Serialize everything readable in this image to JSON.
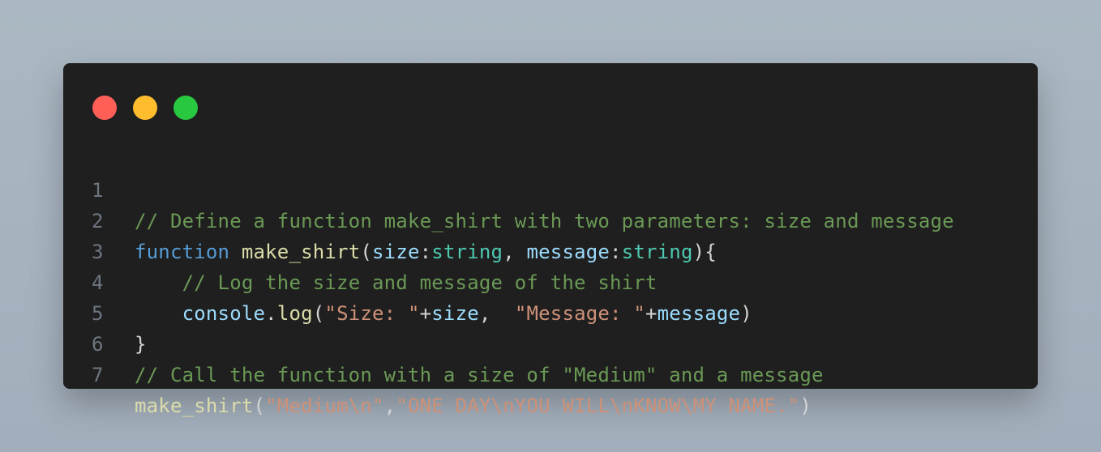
{
  "window": {
    "controls": {
      "close_color": "#ff5f57",
      "minimize_color": "#ffbd2e",
      "maximize_color": "#28c840"
    }
  },
  "code": {
    "lines": [
      {
        "number": "1",
        "tokens": [
          {
            "text": "// Define a function make_shirt with two parameters: size and message",
            "type": "comment"
          }
        ]
      },
      {
        "number": "2",
        "tokens": [
          {
            "text": "function",
            "type": "keyword"
          },
          {
            "text": " ",
            "type": "punct"
          },
          {
            "text": "make_shirt",
            "type": "function"
          },
          {
            "text": "(",
            "type": "punct"
          },
          {
            "text": "size",
            "type": "variable"
          },
          {
            "text": ":",
            "type": "punct"
          },
          {
            "text": "string",
            "type": "type"
          },
          {
            "text": ", ",
            "type": "punct"
          },
          {
            "text": "message",
            "type": "variable"
          },
          {
            "text": ":",
            "type": "punct"
          },
          {
            "text": "string",
            "type": "type"
          },
          {
            "text": "){",
            "type": "punct"
          }
        ]
      },
      {
        "number": "3",
        "tokens": [
          {
            "text": "    ",
            "type": "punct"
          },
          {
            "text": "// Log the size and message of the shirt",
            "type": "comment"
          }
        ]
      },
      {
        "number": "4",
        "tokens": [
          {
            "text": "    ",
            "type": "punct"
          },
          {
            "text": "console",
            "type": "variable"
          },
          {
            "text": ".",
            "type": "punct"
          },
          {
            "text": "log",
            "type": "function"
          },
          {
            "text": "(",
            "type": "punct"
          },
          {
            "text": "\"Size: \"",
            "type": "string"
          },
          {
            "text": "+",
            "type": "punct"
          },
          {
            "text": "size",
            "type": "variable"
          },
          {
            "text": ",  ",
            "type": "punct"
          },
          {
            "text": "\"Message: \"",
            "type": "string"
          },
          {
            "text": "+",
            "type": "punct"
          },
          {
            "text": "message",
            "type": "variable"
          },
          {
            "text": ")",
            "type": "punct"
          }
        ]
      },
      {
        "number": "5",
        "tokens": [
          {
            "text": "}",
            "type": "punct"
          }
        ]
      },
      {
        "number": "6",
        "tokens": [
          {
            "text": "// Call the function with a size of \"Medium\" and a message",
            "type": "comment"
          }
        ]
      },
      {
        "number": "7",
        "tokens": [
          {
            "text": "make_shirt",
            "type": "function"
          },
          {
            "text": "(",
            "type": "punct"
          },
          {
            "text": "\"Medium\\n\"",
            "type": "string"
          },
          {
            "text": ",",
            "type": "punct"
          },
          {
            "text": "\"ONE DAY\\nYOU WILL\\nKNOW\\MY NAME.\"",
            "type": "string"
          },
          {
            "text": ")",
            "type": "punct"
          }
        ]
      }
    ]
  },
  "colors": {
    "background": "#a7b3bf",
    "editor_background": "#1f1f1f",
    "line_number": "#6e7681",
    "comment": "#6a9955",
    "keyword": "#569cd6",
    "function": "#dcdcaa",
    "variable": "#9cdcfe",
    "type": "#4ec9b0",
    "string": "#ce9178",
    "punctuation": "#d4d4d4"
  }
}
